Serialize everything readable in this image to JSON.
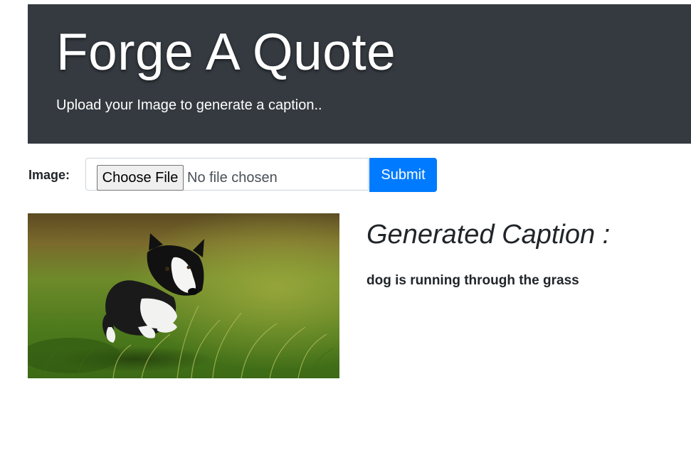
{
  "header": {
    "title": "Forge A Quote",
    "subtitle": "Upload your Image to generate a caption.."
  },
  "form": {
    "image_label": "Image:",
    "choose_file_label": "Choose File",
    "no_file_text": "No file chosen",
    "submit_label": "Submit"
  },
  "result": {
    "image_description": "photo",
    "heading": "Generated Caption :",
    "caption": "dog is running through the grass"
  },
  "colors": {
    "header_bg": "#343a40",
    "submit_bg": "#007bff"
  }
}
